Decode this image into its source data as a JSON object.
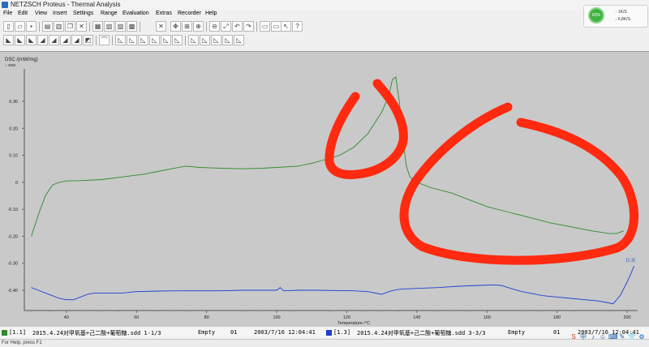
{
  "window": {
    "title": "NETZSCH Proteus - Thermal Analysis"
  },
  "net_widget": {
    "percent": "83%",
    "upload": "1K/S",
    "download": "6.8K/S"
  },
  "menu": [
    "File",
    "Edit",
    "View",
    "Insert",
    "Settings",
    "Range",
    "Evaluation",
    "Extras",
    "Recorder",
    "Help"
  ],
  "toolbar_icons": [
    "new-file-icon",
    "open-icon",
    "save-icon",
    "print-icon",
    "print-preview-icon",
    "copy-icon",
    "close-icon",
    "table-icon",
    "multi-chart-icon",
    "chart-icon",
    "chart-range-icon",
    "delete-icon",
    "arrows-icon",
    "fit-icon",
    "zoom-icon",
    "zoom-out-icon",
    "zoom-full-icon",
    "undo-zoom-icon",
    "redo-zoom-icon",
    "cursor-icon",
    "help-cursor-icon"
  ],
  "toolbar2_icons": [
    "curve-a-icon",
    "curve-b-icon",
    "curve-c-icon",
    "curve-d-icon",
    "curve-e-icon",
    "curve-f-icon",
    "curve-g-icon",
    "tool-icon",
    "peak-icon",
    "onset-icon",
    "area-icon",
    "step-icon",
    "width-icon",
    "tangent-icon",
    "marker-icon",
    "text-icon",
    "rect-icon",
    "frame-icon"
  ],
  "chart_data": {
    "type": "line",
    "ylabel": "DSC /(mW/mg)",
    "exo_label": "↓ exo",
    "xlabel": "Temperature /°C",
    "xlim": [
      28,
      203
    ],
    "ylim": [
      -0.475,
      0.42
    ],
    "x_ticks": [
      40,
      60,
      80,
      100,
      120,
      140,
      160,
      180,
      200
    ],
    "y_ticks": [
      -0.4,
      -0.3,
      -0.2,
      -0.1,
      0,
      0.1,
      0.2,
      0.3
    ],
    "y_tick_labels": [
      "-0.40",
      "-0.30",
      "-0.20",
      "-0.10",
      "0",
      "0.10",
      "0.20",
      "0.30"
    ],
    "series": [
      {
        "color": "#2e8b2e",
        "x": [
          30,
          32,
          34,
          36,
          38,
          40,
          44,
          50,
          56,
          62,
          66,
          70,
          74,
          78,
          84,
          90,
          96,
          100,
          106,
          110,
          114,
          118,
          122,
          126,
          130,
          132,
          133,
          134,
          135,
          136,
          137,
          138,
          140,
          144,
          150,
          156,
          160,
          166,
          172,
          178,
          184,
          190,
          195,
          197,
          199
        ],
        "y": [
          -0.2,
          -0.12,
          -0.05,
          -0.01,
          0.0,
          0.005,
          0.006,
          0.01,
          0.02,
          0.03,
          0.04,
          0.05,
          0.06,
          0.055,
          0.052,
          0.05,
          0.052,
          0.055,
          0.06,
          0.07,
          0.085,
          0.1,
          0.13,
          0.18,
          0.26,
          0.32,
          0.38,
          0.39,
          0.3,
          0.16,
          0.06,
          0.02,
          0.0,
          -0.02,
          -0.04,
          -0.07,
          -0.09,
          -0.11,
          -0.13,
          -0.15,
          -0.165,
          -0.18,
          -0.19,
          -0.19,
          -0.18
        ]
      },
      {
        "color": "#1e3fd0",
        "x": [
          30,
          32,
          34,
          36,
          38,
          40,
          42,
          44,
          46,
          48,
          52,
          56,
          60,
          66,
          72,
          78,
          84,
          90,
          96,
          100,
          101,
          102,
          106,
          112,
          118,
          122,
          126,
          130,
          132,
          134,
          136,
          140,
          146,
          152,
          158,
          162,
          164,
          166,
          170,
          176,
          180,
          184,
          188,
          192,
          194,
          196,
          198,
          200,
          201,
          202
        ],
        "y": [
          -0.39,
          -0.4,
          -0.41,
          -0.42,
          -0.43,
          -0.435,
          -0.435,
          -0.425,
          -0.415,
          -0.41,
          -0.41,
          -0.41,
          -0.405,
          -0.403,
          -0.402,
          -0.402,
          -0.402,
          -0.4,
          -0.4,
          -0.4,
          -0.39,
          -0.402,
          -0.4,
          -0.4,
          -0.401,
          -0.402,
          -0.405,
          -0.415,
          -0.405,
          -0.398,
          -0.395,
          -0.393,
          -0.39,
          -0.385,
          -0.382,
          -0.38,
          -0.382,
          -0.39,
          -0.405,
          -0.42,
          -0.425,
          -0.43,
          -0.435,
          -0.44,
          -0.445,
          -0.45,
          -0.42,
          -0.37,
          -0.34,
          -0.31
        ]
      }
    ],
    "annotations": [
      {
        "text": "[1.3]",
        "x": 201,
        "y": -0.3,
        "color": "#1e3fd0"
      }
    ]
  },
  "status": {
    "row1_id": "[1.1]",
    "row1_file": "2015.4.24对甲氧基+己二酸+葡萄糖.sdd 1-1/3",
    "row1_state": "Empty",
    "row1_seg": "01",
    "row1_date": "2003/7/16 12:04:41",
    "row2_id": "[1.3]",
    "row2_file": "2015.4.24对甲氧基+己二酸+葡萄糖.sdd 3-3/3",
    "row2_state": "Empty",
    "row2_seg": "01",
    "row2_date": "2003/7/16 12:04:41",
    "row1_color": "#2e8b2e",
    "row2_color": "#1e3fd0"
  },
  "help_text": "For Help, press F1",
  "ime_labels": [
    "S",
    "中",
    "♪",
    "☺",
    "⌨",
    "✎",
    "👕",
    "⚙"
  ]
}
